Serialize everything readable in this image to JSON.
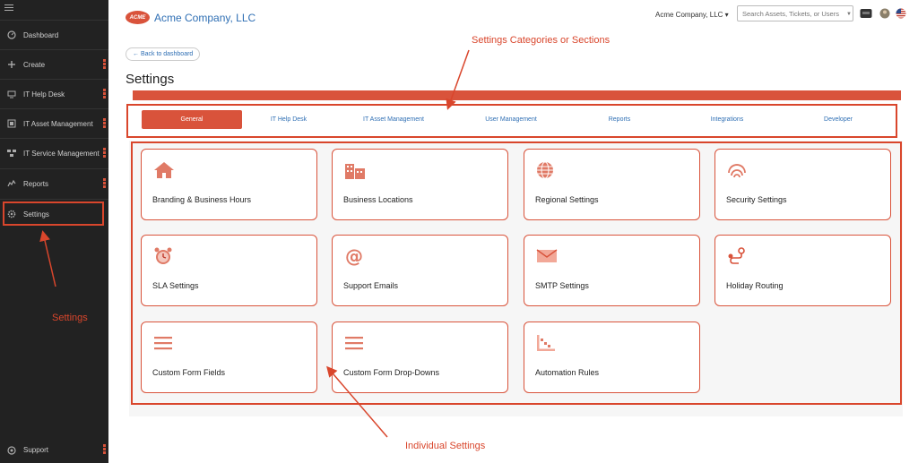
{
  "sidebar": {
    "items": [
      {
        "label": "Dashboard",
        "icon": "dashboard-icon",
        "has_more": false
      },
      {
        "label": "Create",
        "icon": "plus-icon",
        "has_more": true
      },
      {
        "label": "IT Help Desk",
        "icon": "monitor-icon",
        "has_more": true
      },
      {
        "label": "IT Asset Management",
        "icon": "asset-icon",
        "has_more": true
      },
      {
        "label": "IT Service Management",
        "icon": "service-icon",
        "has_more": true
      },
      {
        "label": "Reports",
        "icon": "chart-icon",
        "has_more": true
      },
      {
        "label": "Settings",
        "icon": "gear-icon",
        "has_more": false
      }
    ],
    "support_label": "Support"
  },
  "header": {
    "logo_text": "ACME",
    "company_name": "Acme Company, LLC",
    "company_dropdown": "Acme Company, LLC ▾",
    "search_placeholder": "Search Assets, Tickets, or Users"
  },
  "back_label": "← Back to dashboard",
  "page_title": "Settings",
  "tabs": [
    {
      "label": "General",
      "active": true
    },
    {
      "label": "IT Help Desk",
      "active": false
    },
    {
      "label": "IT Asset Management",
      "active": false
    },
    {
      "label": "User Management",
      "active": false
    },
    {
      "label": "Reports",
      "active": false
    },
    {
      "label": "Integrations",
      "active": false
    },
    {
      "label": "Developer",
      "active": false
    }
  ],
  "cards": [
    {
      "label": "Branding & Business Hours",
      "icon": "house-icon"
    },
    {
      "label": "Business Locations",
      "icon": "building-icon"
    },
    {
      "label": "Regional Settings",
      "icon": "globe-icon"
    },
    {
      "label": "Security Settings",
      "icon": "fingerprint-icon"
    },
    {
      "label": "SLA Settings",
      "icon": "alarm-clock-icon"
    },
    {
      "label": "Support Emails",
      "icon": "at-sign-icon"
    },
    {
      "label": "SMTP Settings",
      "icon": "envelope-icon"
    },
    {
      "label": "Holiday Routing",
      "icon": "route-icon"
    },
    {
      "label": "Custom Form Fields",
      "icon": "list-icon"
    },
    {
      "label": "Custom Form Drop-Downs",
      "icon": "list-icon"
    },
    {
      "label": "Automation Rules",
      "icon": "automation-icon"
    }
  ],
  "annotations": {
    "categories": "Settings Categories or Sections",
    "settings": "Settings",
    "individual": "Individual Settings"
  },
  "colors": {
    "accent": "#d9533b",
    "annotation": "#d9462c",
    "link": "#2f6fb4",
    "sidebar_bg": "#222222"
  }
}
